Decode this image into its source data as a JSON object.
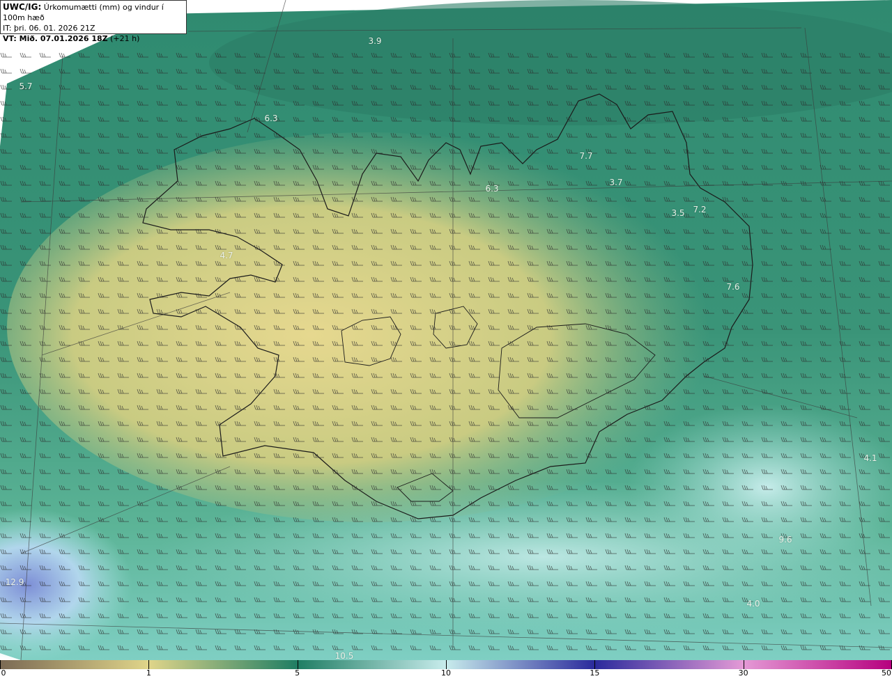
{
  "header": {
    "product": "UWC/IG:",
    "title": " Úrkomumætti (mm) og vindur í 100m hæð",
    "it_line": "IT: þri. 06. 01. 2026 21Z",
    "vt_label": "VT: Mið. 07.01.2026 18Z",
    "vt_offset": " (+21 h)"
  },
  "map": {
    "region": "Iceland",
    "value_labels": [
      {
        "text": "3.9"
      },
      {
        "text": "5.7"
      },
      {
        "text": "6.3"
      },
      {
        "text": "7.7"
      },
      {
        "text": "3.7"
      },
      {
        "text": "6.3"
      },
      {
        "text": "3.5"
      },
      {
        "text": "7.2"
      },
      {
        "text": "4.7"
      },
      {
        "text": "7.6"
      },
      {
        "text": "4.1"
      },
      {
        "text": "12.9"
      },
      {
        "text": "4.0"
      },
      {
        "text": "10.5"
      },
      {
        "text": "9.6"
      }
    ],
    "colors": {
      "land_low": "#d9d58a",
      "sea_mid": "#3f9b7c",
      "sea_dark": "#2a7a68",
      "high": "#bde6e4",
      "very_high": "#6e86cc"
    }
  },
  "colorbar": {
    "ticks": [
      "0",
      "1",
      "5",
      "10",
      "15",
      "30",
      "50"
    ],
    "colors": [
      "#7b6a54",
      "#e0d58a",
      "#1f7d63",
      "#c8ecec",
      "#2a2a9c",
      "#e49ad6",
      "#b6007e"
    ]
  }
}
